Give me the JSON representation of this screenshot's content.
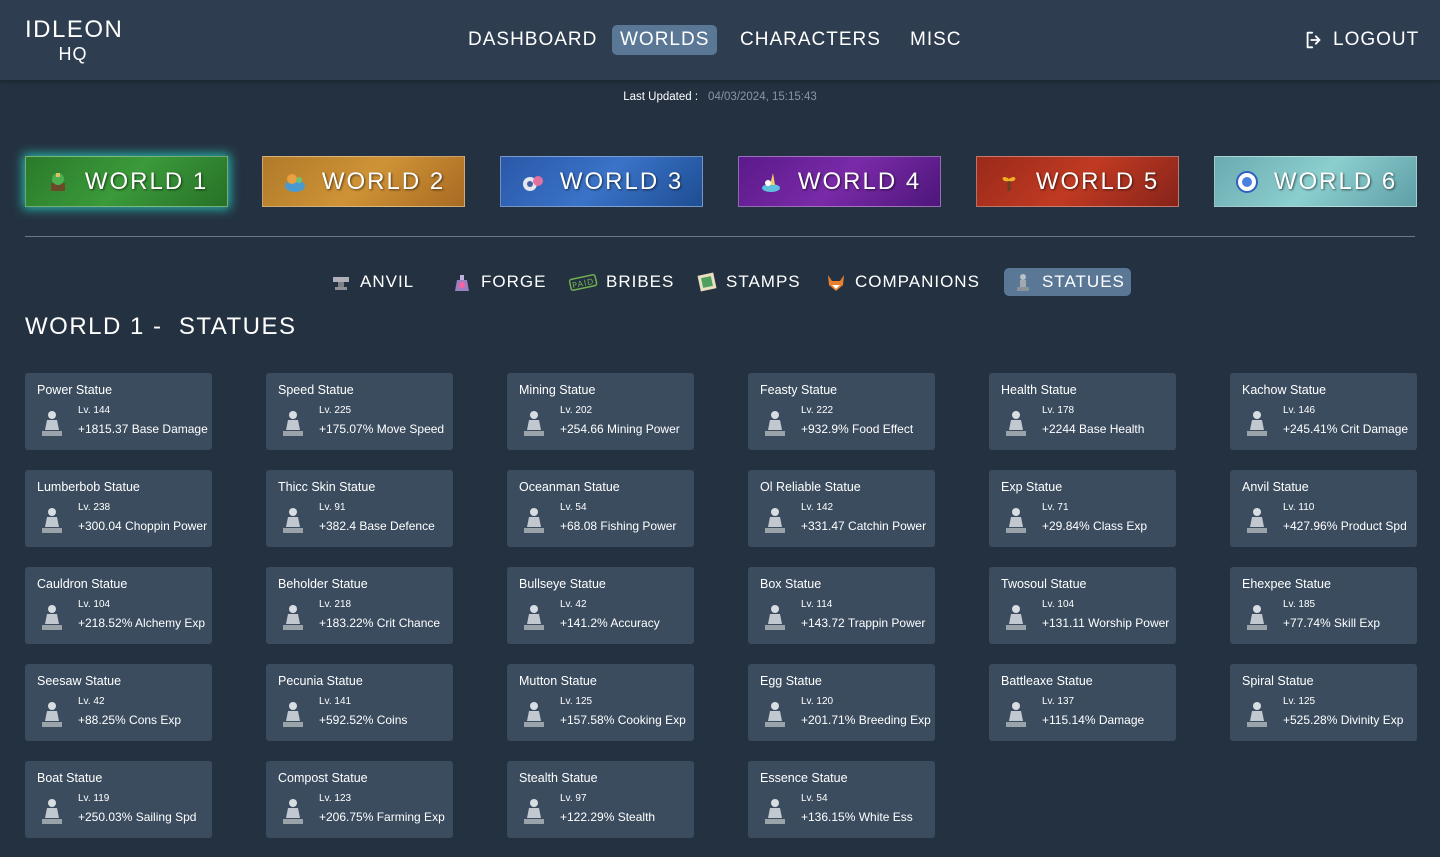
{
  "app": {
    "logo_title": "IDLEON",
    "logo_sub": "HQ"
  },
  "nav": {
    "items": [
      "DASHBOARD",
      "WORLDS",
      "CHARACTERS",
      "MISC"
    ],
    "active": "WORLDS",
    "logout": "LOGOUT"
  },
  "updated": {
    "label": "Last Updated :",
    "timestamp": "04/03/2024, 15:15:43"
  },
  "worlds": [
    "WORLD 1",
    "WORLD 2",
    "WORLD 3",
    "WORLD 4",
    "WORLD 5",
    "WORLD 6"
  ],
  "active_world": "WORLD 1",
  "subtabs": [
    {
      "label": "ANVIL",
      "icon": "anvil-icon"
    },
    {
      "label": "FORGE",
      "icon": "forge-icon"
    },
    {
      "label": "BRIBES",
      "icon": "paid-stamp-icon"
    },
    {
      "label": "STAMPS",
      "icon": "stamp-icon"
    },
    {
      "label": "COMPANIONS",
      "icon": "fox-icon"
    },
    {
      "label": "STATUES",
      "icon": "statue-icon"
    }
  ],
  "active_subtab": "STATUES",
  "page_title": "WORLD 1 -  STATUES",
  "statues": [
    {
      "name": "Power Statue",
      "level": "Lv. 144",
      "bonus": "+1815.37 Base Damage"
    },
    {
      "name": "Speed Statue",
      "level": "Lv. 225",
      "bonus": "+175.07% Move Speed"
    },
    {
      "name": "Mining Statue",
      "level": "Lv. 202",
      "bonus": "+254.66 Mining Power"
    },
    {
      "name": "Feasty Statue",
      "level": "Lv. 222",
      "bonus": "+932.9% Food Effect"
    },
    {
      "name": "Health Statue",
      "level": "Lv. 178",
      "bonus": "+2244 Base Health"
    },
    {
      "name": "Kachow Statue",
      "level": "Lv. 146",
      "bonus": "+245.41% Crit Damage"
    },
    {
      "name": "Lumberbob Statue",
      "level": "Lv. 238",
      "bonus": "+300.04 Choppin Power"
    },
    {
      "name": "Thicc Skin Statue",
      "level": "Lv. 91",
      "bonus": "+382.4 Base Defence"
    },
    {
      "name": "Oceanman Statue",
      "level": "Lv. 54",
      "bonus": "+68.08 Fishing Power"
    },
    {
      "name": "Ol Reliable Statue",
      "level": "Lv. 142",
      "bonus": "+331.47 Catchin Power"
    },
    {
      "name": "Exp Statue",
      "level": "Lv. 71",
      "bonus": "+29.84% Class Exp"
    },
    {
      "name": "Anvil Statue",
      "level": "Lv. 110",
      "bonus": "+427.96% Product Spd"
    },
    {
      "name": "Cauldron Statue",
      "level": "Lv. 104",
      "bonus": "+218.52% Alchemy Exp"
    },
    {
      "name": "Beholder Statue",
      "level": "Lv. 218",
      "bonus": "+183.22% Crit Chance"
    },
    {
      "name": "Bullseye Statue",
      "level": "Lv. 42",
      "bonus": "+141.2% Accuracy"
    },
    {
      "name": "Box Statue",
      "level": "Lv. 114",
      "bonus": "+143.72 Trappin Power"
    },
    {
      "name": "Twosoul Statue",
      "level": "Lv. 104",
      "bonus": "+131.11 Worship Power"
    },
    {
      "name": "Ehexpee Statue",
      "level": "Lv. 185",
      "bonus": "+77.74% Skill Exp"
    },
    {
      "name": "Seesaw Statue",
      "level": "Lv. 42",
      "bonus": "+88.25% Cons Exp"
    },
    {
      "name": "Pecunia Statue",
      "level": "Lv. 141",
      "bonus": "+592.52% Coins"
    },
    {
      "name": "Mutton Statue",
      "level": "Lv. 125",
      "bonus": "+157.58% Cooking Exp"
    },
    {
      "name": "Egg Statue",
      "level": "Lv. 120",
      "bonus": "+201.71% Breeding Exp"
    },
    {
      "name": "Battleaxe Statue",
      "level": "Lv. 137",
      "bonus": "+115.14% Damage"
    },
    {
      "name": "Spiral Statue",
      "level": "Lv. 125",
      "bonus": "+525.28% Divinity Exp"
    },
    {
      "name": "Boat Statue",
      "level": "Lv. 119",
      "bonus": "+250.03% Sailing Spd"
    },
    {
      "name": "Compost Statue",
      "level": "Lv. 123",
      "bonus": "+206.75% Farming Exp"
    },
    {
      "name": "Stealth Statue",
      "level": "Lv. 97",
      "bonus": "+122.29% Stealth"
    },
    {
      "name": "Essence Statue",
      "level": "Lv. 54",
      "bonus": "+136.15% White Ess"
    }
  ]
}
